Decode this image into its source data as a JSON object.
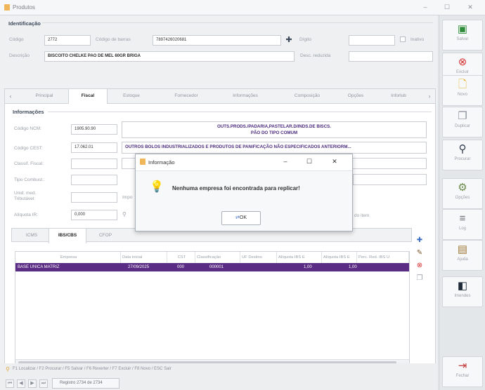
{
  "window": {
    "title": "Produtos",
    "minimize": "–",
    "maximize": "☐",
    "close": "✕"
  },
  "ident": {
    "section": "Identificação",
    "codigo_label": "Código",
    "codigo": "2772",
    "barras_label": "Código de barras",
    "barras": "7897426020681",
    "digito_label": "Dígito",
    "digito": "",
    "inativo_label": "Inativo",
    "descricao_label": "Descrição",
    "descricao": "BISCOITO CHELKE PAO DE MEL 60GR BRIGA",
    "desc_reduzida_label": "Desc. reduzida",
    "desc_reduzida": ""
  },
  "tabs": [
    "Principal",
    "Fiscal",
    "Estoque",
    "Fornecedor",
    "Informações",
    "Composição",
    "Opções",
    "Inforlub"
  ],
  "fiscal": {
    "section": "Informações",
    "ncm_label": "Código NCM:",
    "ncm": "1905.90.90",
    "ncm_desc_line1": "OUTS.PRODS./PADARIA,PASTELAR.D/INDS.DE BISCS.",
    "ncm_desc_line2": "PÃO DO TIPO COMUM",
    "cest_label": "Código CEST:",
    "cest": "17.062.01",
    "cest_desc": "OUTROS BOLOS INDUSTRIALIZADOS E PRODUTOS DE PANIFICAÇÃO NÃO ESPECIFICADOS ANTERIORM...",
    "classif_label": "Classif. Fiscal:",
    "tipo_comb_label": "Tipo Combust.:",
    "unid_label_1": "Unid. med.",
    "unid_label_2": "Tributável:",
    "import_label": "Impo",
    "aliquota_label": "Alíquota IR:",
    "aliquota": "0,000",
    "item_label": "do item"
  },
  "subtabs": [
    "ICMS",
    "IBS/CBS",
    "CFOP"
  ],
  "grid": {
    "headers": [
      "Empresa",
      "Data inicial",
      "CST",
      "Classificação",
      "UF Destino",
      "Alíquota IBS E",
      "Alíquota IBS E",
      "Perc. Red. IBS U"
    ],
    "row": [
      "BASE UNICA MATRIZ",
      "27/09/2025",
      "000",
      "000001",
      "",
      "1,00",
      "1,00",
      ""
    ]
  },
  "dialog": {
    "title": "Informação",
    "message": "Nenhuma empresa foi encontrada para replicar!",
    "ok": "OK"
  },
  "status": {
    "shortcuts": "F1 Localizar / F2 Procurar / F5 Salvar / F6 Reverter / F7 Excluir / F8 Novo / ESC Sair",
    "record": "Registro 2734 de 2734"
  },
  "sidebar": [
    "Salvar",
    "Excluir",
    "Novo",
    "Duplicar",
    "Procurar",
    "Opções",
    "Log",
    "Ajuda",
    "Imendes",
    "Fechar"
  ],
  "colors": {
    "accent": "#5b2c83",
    "purple_text": "#4a2a7c"
  }
}
